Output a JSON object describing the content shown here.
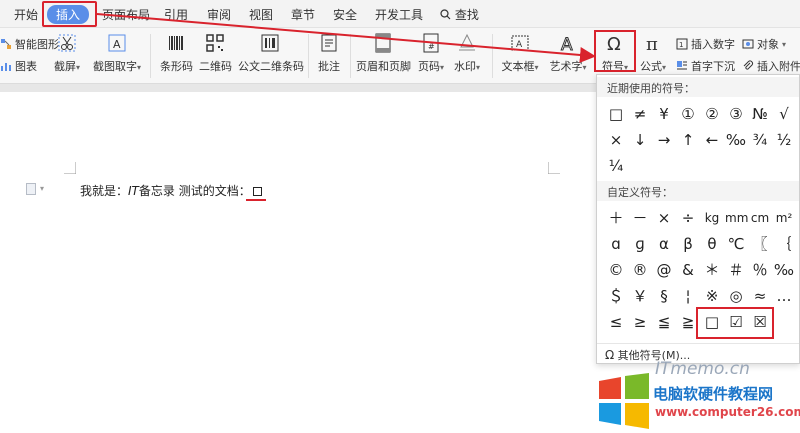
{
  "menu": {
    "items": [
      "开始",
      "插入",
      "页面布局",
      "引用",
      "审阅",
      "视图",
      "章节",
      "安全",
      "开发工具",
      "查找"
    ],
    "active": "插入"
  },
  "toolbar": {
    "smart_shape": "智能图形",
    "chart": "图表",
    "screenshot": "截屏",
    "screenshot_text": "截图取字",
    "barcode": "条形码",
    "qrcode": "二维码",
    "doc_barcode": "公文二维条码",
    "comment": "批注",
    "header_footer": "页眉和页脚",
    "page_number": "页码",
    "watermark": "水印",
    "textbox": "文本框",
    "wordart": "艺术字",
    "symbol": "符号",
    "formula": "公式",
    "insert_number": "插入数字",
    "object": "对象",
    "drop_cap": "首字下沉",
    "attachment": "插入附件"
  },
  "document": {
    "text_prefix": "我就是：",
    "text_it": "IT",
    "text_rest": "备忘录 测试的文档："
  },
  "symbol_panel": {
    "recent_title": "近期使用的符号：",
    "recent": [
      "□",
      "≠",
      "¥",
      "①",
      "②",
      "③",
      "№",
      "√",
      "×",
      "↓",
      "→",
      "↑",
      "←",
      "‰",
      "¾",
      "½",
      "¼"
    ],
    "custom_title": "自定义符号：",
    "custom": [
      "＋",
      "－",
      "×",
      "÷",
      "kg",
      "mm",
      "cm",
      "m²",
      "ɑ",
      "ɡ",
      "α",
      "β",
      "θ",
      "℃",
      "〖",
      "｛",
      "©",
      "®",
      "@",
      "&",
      "＊",
      "＃",
      "％",
      "‰",
      "＄",
      "￥",
      "§",
      "¦",
      "※",
      "◎",
      "≈",
      "…",
      "≤",
      "≥",
      "≦",
      "≧",
      "□",
      "☑",
      "☒"
    ],
    "more": "其他符号(M)..."
  },
  "watermark": {
    "site": "ITmemo.cn",
    "brand": "电脑软硬件教程网",
    "url": "www.computer26.com"
  },
  "colors": {
    "accent": "#5a8ee8",
    "highlight": "#d9232d"
  }
}
